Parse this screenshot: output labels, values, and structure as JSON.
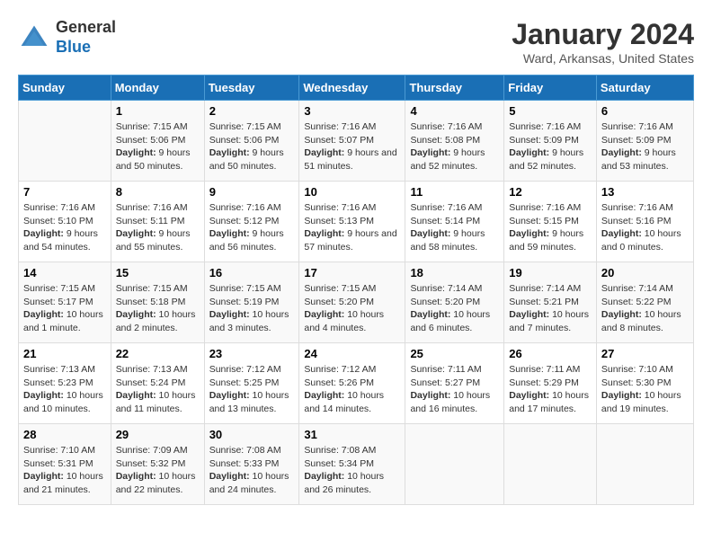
{
  "app": {
    "name_general": "General",
    "name_blue": "Blue"
  },
  "title": "January 2024",
  "location": "Ward, Arkansas, United States",
  "days_of_week": [
    "Sunday",
    "Monday",
    "Tuesday",
    "Wednesday",
    "Thursday",
    "Friday",
    "Saturday"
  ],
  "weeks": [
    [
      {
        "day": "",
        "sunrise": "",
        "sunset": "",
        "daylight": ""
      },
      {
        "day": "1",
        "sunrise": "7:15 AM",
        "sunset": "5:06 PM",
        "daylight": "9 hours and 50 minutes."
      },
      {
        "day": "2",
        "sunrise": "7:15 AM",
        "sunset": "5:06 PM",
        "daylight": "9 hours and 50 minutes."
      },
      {
        "day": "3",
        "sunrise": "7:16 AM",
        "sunset": "5:07 PM",
        "daylight": "9 hours and 51 minutes."
      },
      {
        "day": "4",
        "sunrise": "7:16 AM",
        "sunset": "5:08 PM",
        "daylight": "9 hours and 52 minutes."
      },
      {
        "day": "5",
        "sunrise": "7:16 AM",
        "sunset": "5:09 PM",
        "daylight": "9 hours and 52 minutes."
      },
      {
        "day": "6",
        "sunrise": "7:16 AM",
        "sunset": "5:09 PM",
        "daylight": "9 hours and 53 minutes."
      }
    ],
    [
      {
        "day": "7",
        "sunrise": "7:16 AM",
        "sunset": "5:10 PM",
        "daylight": "9 hours and 54 minutes."
      },
      {
        "day": "8",
        "sunrise": "7:16 AM",
        "sunset": "5:11 PM",
        "daylight": "9 hours and 55 minutes."
      },
      {
        "day": "9",
        "sunrise": "7:16 AM",
        "sunset": "5:12 PM",
        "daylight": "9 hours and 56 minutes."
      },
      {
        "day": "10",
        "sunrise": "7:16 AM",
        "sunset": "5:13 PM",
        "daylight": "9 hours and 57 minutes."
      },
      {
        "day": "11",
        "sunrise": "7:16 AM",
        "sunset": "5:14 PM",
        "daylight": "9 hours and 58 minutes."
      },
      {
        "day": "12",
        "sunrise": "7:16 AM",
        "sunset": "5:15 PM",
        "daylight": "9 hours and 59 minutes."
      },
      {
        "day": "13",
        "sunrise": "7:16 AM",
        "sunset": "5:16 PM",
        "daylight": "10 hours and 0 minutes."
      }
    ],
    [
      {
        "day": "14",
        "sunrise": "7:15 AM",
        "sunset": "5:17 PM",
        "daylight": "10 hours and 1 minute."
      },
      {
        "day": "15",
        "sunrise": "7:15 AM",
        "sunset": "5:18 PM",
        "daylight": "10 hours and 2 minutes."
      },
      {
        "day": "16",
        "sunrise": "7:15 AM",
        "sunset": "5:19 PM",
        "daylight": "10 hours and 3 minutes."
      },
      {
        "day": "17",
        "sunrise": "7:15 AM",
        "sunset": "5:20 PM",
        "daylight": "10 hours and 4 minutes."
      },
      {
        "day": "18",
        "sunrise": "7:14 AM",
        "sunset": "5:20 PM",
        "daylight": "10 hours and 6 minutes."
      },
      {
        "day": "19",
        "sunrise": "7:14 AM",
        "sunset": "5:21 PM",
        "daylight": "10 hours and 7 minutes."
      },
      {
        "day": "20",
        "sunrise": "7:14 AM",
        "sunset": "5:22 PM",
        "daylight": "10 hours and 8 minutes."
      }
    ],
    [
      {
        "day": "21",
        "sunrise": "7:13 AM",
        "sunset": "5:23 PM",
        "daylight": "10 hours and 10 minutes."
      },
      {
        "day": "22",
        "sunrise": "7:13 AM",
        "sunset": "5:24 PM",
        "daylight": "10 hours and 11 minutes."
      },
      {
        "day": "23",
        "sunrise": "7:12 AM",
        "sunset": "5:25 PM",
        "daylight": "10 hours and 13 minutes."
      },
      {
        "day": "24",
        "sunrise": "7:12 AM",
        "sunset": "5:26 PM",
        "daylight": "10 hours and 14 minutes."
      },
      {
        "day": "25",
        "sunrise": "7:11 AM",
        "sunset": "5:27 PM",
        "daylight": "10 hours and 16 minutes."
      },
      {
        "day": "26",
        "sunrise": "7:11 AM",
        "sunset": "5:29 PM",
        "daylight": "10 hours and 17 minutes."
      },
      {
        "day": "27",
        "sunrise": "7:10 AM",
        "sunset": "5:30 PM",
        "daylight": "10 hours and 19 minutes."
      }
    ],
    [
      {
        "day": "28",
        "sunrise": "7:10 AM",
        "sunset": "5:31 PM",
        "daylight": "10 hours and 21 minutes."
      },
      {
        "day": "29",
        "sunrise": "7:09 AM",
        "sunset": "5:32 PM",
        "daylight": "10 hours and 22 minutes."
      },
      {
        "day": "30",
        "sunrise": "7:08 AM",
        "sunset": "5:33 PM",
        "daylight": "10 hours and 24 minutes."
      },
      {
        "day": "31",
        "sunrise": "7:08 AM",
        "sunset": "5:34 PM",
        "daylight": "10 hours and 26 minutes."
      },
      {
        "day": "",
        "sunrise": "",
        "sunset": "",
        "daylight": ""
      },
      {
        "day": "",
        "sunrise": "",
        "sunset": "",
        "daylight": ""
      },
      {
        "day": "",
        "sunrise": "",
        "sunset": "",
        "daylight": ""
      }
    ]
  ],
  "labels": {
    "sunrise": "Sunrise:",
    "sunset": "Sunset:",
    "daylight": "Daylight:"
  }
}
